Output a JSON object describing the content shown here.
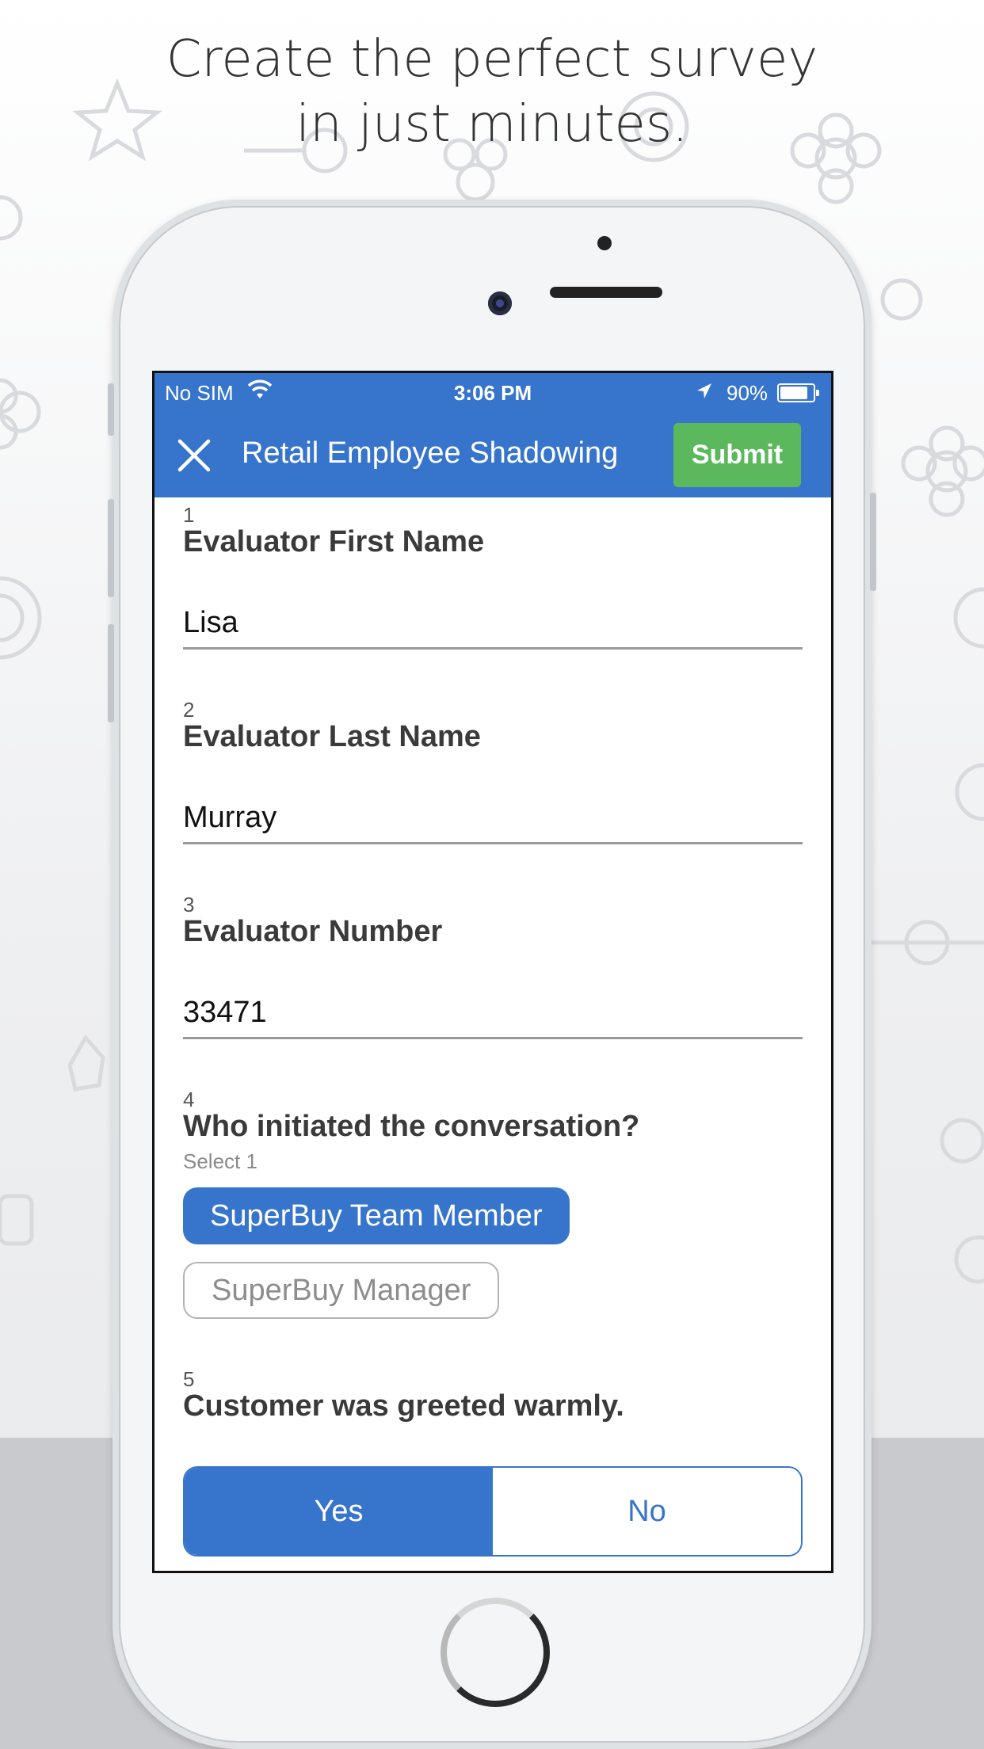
{
  "headline": {
    "line1": "Create the perfect survey",
    "line2": "in just minutes."
  },
  "status_bar": {
    "carrier": "No SIM",
    "time": "3:06 PM",
    "battery_percent": "90%",
    "battery_level": 0.9
  },
  "nav": {
    "close_icon": "close-icon",
    "title": "Retail Employee Shadowing",
    "submit_label": "Submit"
  },
  "questions": [
    {
      "number": "1",
      "label": "Evaluator First Name",
      "value": "Lisa"
    },
    {
      "number": "2",
      "label": "Evaluator Last Name",
      "value": "Murray"
    },
    {
      "number": "3",
      "label": "Evaluator Number",
      "value": "33471"
    },
    {
      "number": "4",
      "label": "Who initiated the conversation?",
      "hint": "Select 1",
      "options": [
        "SuperBuy Team Member",
        "SuperBuy Manager"
      ],
      "selected": "SuperBuy Team Member"
    },
    {
      "number": "5",
      "label": "Customer was greeted warmly.",
      "options": [
        "Yes",
        "No"
      ],
      "selected": "Yes"
    }
  ],
  "colors": {
    "primary": "#3775cc",
    "submit": "#5cb85c"
  }
}
